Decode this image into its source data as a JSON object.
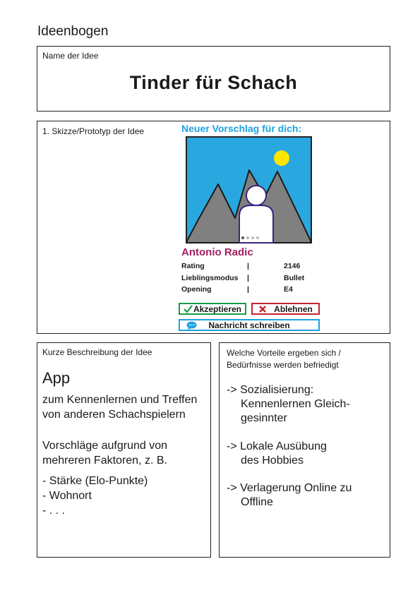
{
  "page": {
    "title": "Ideenbogen"
  },
  "name_box": {
    "label": "Name der Idee",
    "idea_title": "Tinder für Schach"
  },
  "sketch_box": {
    "label": "1. Skizze/Prototyp der Idee",
    "heading": "Neuer Vorschlag für dich:",
    "person_name": "Antonio Radic",
    "info": [
      {
        "key": "Rating",
        "sep": "|",
        "value": "2146"
      },
      {
        "key": "Lieblingsmodus",
        "sep": "|",
        "value": "Bullet"
      },
      {
        "key": "Opening",
        "sep": "|",
        "value": "E4"
      }
    ],
    "accept_label": "Akzeptieren",
    "decline_label": "Ablehnen",
    "message_label": "Nachricht schreiben",
    "colors": {
      "heading": "#1ea1e0",
      "name": "#a31e62",
      "accept": "#1a9b47",
      "decline": "#c4232e",
      "message": "#1ea1e0",
      "sky": "#29a8e0",
      "sun": "#ffe600",
      "mountain": "#808080",
      "person_outline": "#3b2580"
    }
  },
  "description_box": {
    "label": "Kurze Beschreibung der Idee",
    "app": "App",
    "line1": "zum Kennenlernen und Treffen",
    "line2": "von anderen Schachspielern",
    "line3": "Vorschläge aufgrund von",
    "line4": "mehreren Faktoren, z. B.",
    "bullet1": "- Stärke (Elo-Punkte)",
    "bullet2": "- Wohnort",
    "bullet3": "-  . . ."
  },
  "benefits_box": {
    "label_line1": "Welche Vorteile ergeben sich /",
    "label_line2": "Bedürfnisse werden befriedigt",
    "b1_line1": "-> Sozialisierung:",
    "b1_line2": "Kennenlernen Gleich-",
    "b1_line3": "gesinnter",
    "b2_line1": "-> Lokale Ausübung",
    "b2_line2": "des Hobbies",
    "b3_line1": "-> Verlagerung Online zu",
    "b3_line2": "Offline"
  }
}
